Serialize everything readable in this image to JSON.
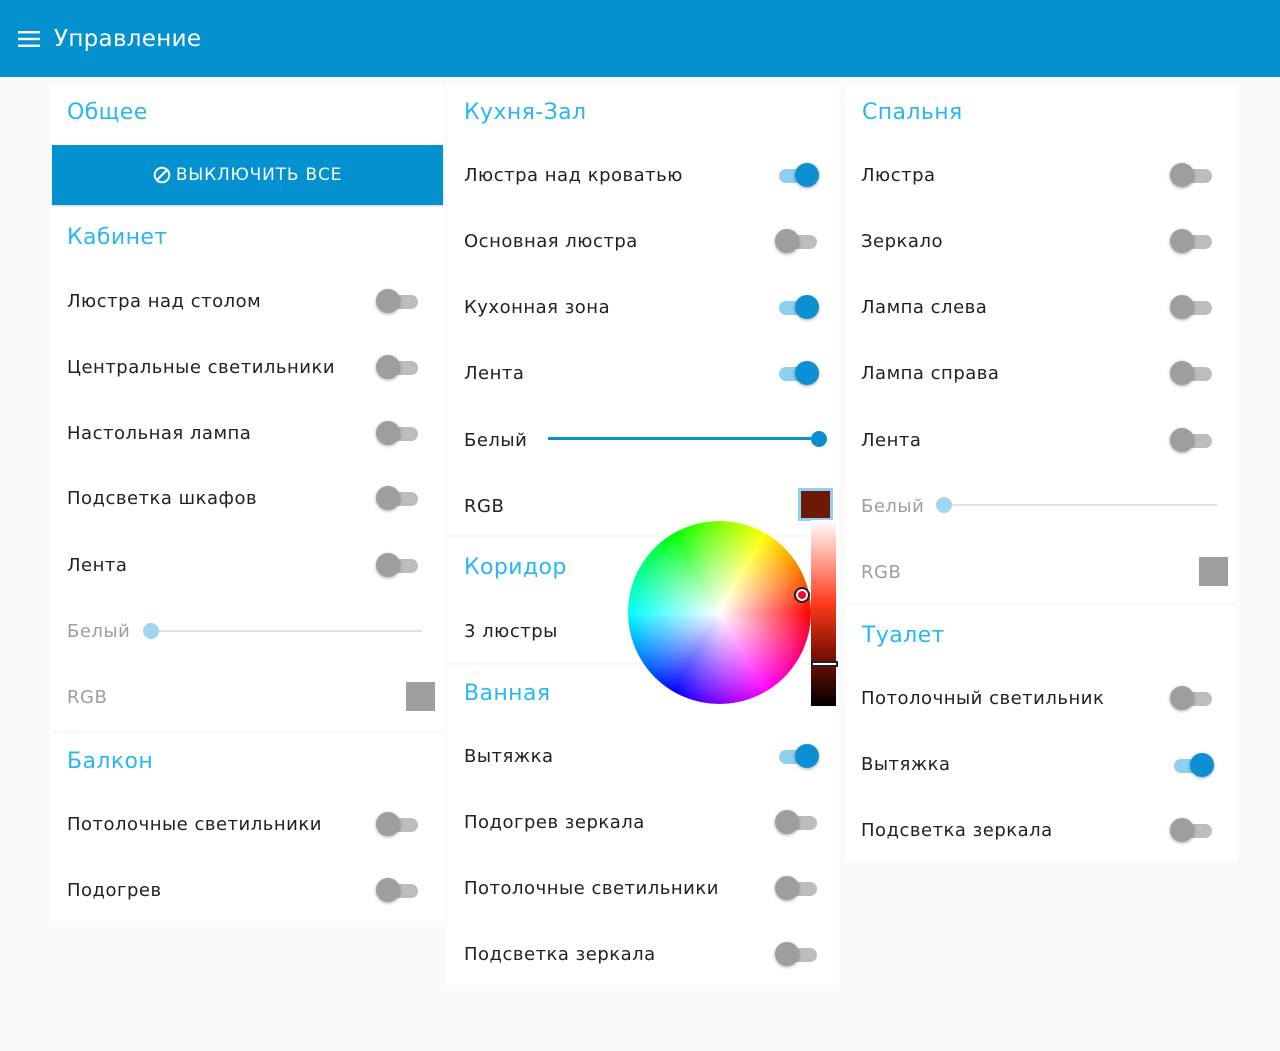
{
  "appbar": {
    "title": "Управление"
  },
  "general": {
    "title": "Общее",
    "off_button": "ВЫКЛЮЧИТЬ ВСЕ"
  },
  "cabinet": {
    "title": "Кабинет",
    "items": [
      {
        "label": "Люстра над столом",
        "on": false
      },
      {
        "label": "Центральные светильники",
        "on": false
      },
      {
        "label": "Настольная лампа",
        "on": false
      },
      {
        "label": "Подсветка шкафов",
        "on": false
      },
      {
        "label": "Лента",
        "on": false
      }
    ],
    "white": {
      "label": "Белый",
      "value": 0
    },
    "rgb": {
      "label": "RGB",
      "color": "#9e9e9e"
    }
  },
  "balcony": {
    "title": "Балкон",
    "items": [
      {
        "label": "Потолочные светильники",
        "on": false
      },
      {
        "label": "Подогрев",
        "on": false
      }
    ]
  },
  "kitchen": {
    "title": "Кухня-Зал",
    "items": [
      {
        "label": "Люстра над кроватью",
        "on": true
      },
      {
        "label": "Основная люстра",
        "on": false
      },
      {
        "label": "Кухонная зона",
        "on": true
      },
      {
        "label": "Лента",
        "on": true
      }
    ],
    "white": {
      "label": "Белый",
      "value": 100
    },
    "rgb": {
      "label": "RGB",
      "color": "#6d1906"
    }
  },
  "corridor": {
    "title": "Коридор",
    "items": [
      {
        "label": "3 люстры"
      }
    ]
  },
  "bath": {
    "title": "Ванная",
    "items": [
      {
        "label": "Вытяжка",
        "on": true
      },
      {
        "label": "Подогрев зеркала",
        "on": false
      },
      {
        "label": "Потолочные светильники",
        "on": false
      },
      {
        "label": "Подсветка зеркала",
        "on": false
      }
    ]
  },
  "bedroom": {
    "title": "Спальня",
    "items": [
      {
        "label": "Люстра",
        "on": false
      },
      {
        "label": "Зеркало",
        "on": false
      },
      {
        "label": "Лампа слева",
        "on": false
      },
      {
        "label": "Лампа справа",
        "on": false
      },
      {
        "label": "Лента",
        "on": false
      }
    ],
    "white": {
      "label": "Белый",
      "value": 0
    },
    "rgb": {
      "label": "RGB",
      "color": "#9e9e9e"
    }
  },
  "toilet": {
    "title": "Туалет",
    "items": [
      {
        "label": "Потолочный светильник",
        "on": false
      },
      {
        "label": "Вытяжка",
        "on": true
      },
      {
        "label": "Подсветка зеркала",
        "on": false
      }
    ]
  },
  "theme": {
    "primary": "#0392cf",
    "accent": "#29b6f6",
    "toggle_on": "#0d8fd3",
    "toggle_off": "#9e9e9e"
  }
}
